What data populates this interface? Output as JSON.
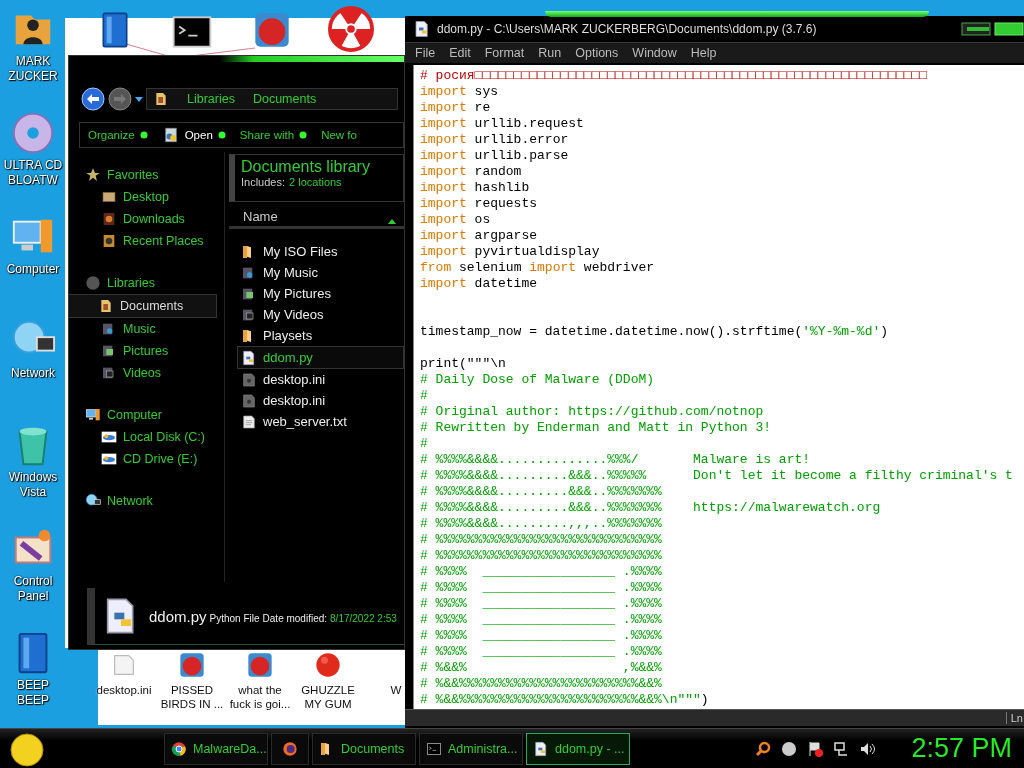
{
  "desktop": {
    "icons": [
      {
        "label": "MARK ZUCKER",
        "kind": "user"
      },
      {
        "label": "ULTRA CD BLOATW",
        "kind": "disc"
      },
      {
        "label": "Computer",
        "kind": "computer"
      },
      {
        "label": "Network",
        "kind": "network"
      },
      {
        "label": "Windows Vista",
        "kind": "recycle"
      },
      {
        "label": "Control Panel",
        "kind": "control"
      },
      {
        "label": "BEEP BEEP",
        "kind": "book"
      }
    ],
    "bottom_icons": [
      {
        "label": "desktop.ini",
        "kind": "paper"
      },
      {
        "label": "PISSED BIRDS IN ...",
        "kind": "game"
      },
      {
        "label": "what the fuck is goi...",
        "kind": "game"
      },
      {
        "label": "GHUZZLE MY GUM",
        "kind": "fuzzy"
      },
      {
        "label": "W",
        "kind": "blank"
      }
    ]
  },
  "explorer": {
    "breadcrumb": [
      "Libraries",
      "Documents"
    ],
    "toolbar": [
      {
        "label": "Organize",
        "kind": "menu"
      },
      {
        "label": "Open",
        "kind": "open"
      },
      {
        "label": "Share with",
        "kind": "menu"
      },
      {
        "label": "New fo",
        "kind": "plain"
      }
    ],
    "nav": [
      {
        "label": "Favorites",
        "kind": "star",
        "selected": false,
        "children": [
          {
            "label": "Desktop",
            "kind": "desktop",
            "selected": false
          },
          {
            "label": "Downloads",
            "kind": "downloads",
            "selected": false
          },
          {
            "label": "Recent Places",
            "kind": "recent",
            "selected": false
          }
        ]
      },
      {
        "label": "Libraries",
        "kind": "libraries",
        "selected": false,
        "children": [
          {
            "label": "Documents",
            "kind": "documents",
            "selected": true
          },
          {
            "label": "Music",
            "kind": "music",
            "selected": false
          },
          {
            "label": "Pictures",
            "kind": "pictures",
            "selected": false
          },
          {
            "label": "Videos",
            "kind": "videos",
            "selected": false
          }
        ]
      },
      {
        "label": "Computer",
        "kind": "computer",
        "selected": false,
        "children": [
          {
            "label": "Local Disk (C:)",
            "kind": "drive",
            "selected": false
          },
          {
            "label": "CD Drive (E:)",
            "kind": "drive",
            "selected": false
          }
        ]
      },
      {
        "label": "Network",
        "kind": "network",
        "selected": false
      }
    ],
    "library": {
      "title": "Documents library",
      "includes_label": "Includes:",
      "locations": "2 locations"
    },
    "column": "Name",
    "files": [
      {
        "name": "My ISO Files",
        "kind": "folder",
        "selected": false
      },
      {
        "name": "My Music",
        "kind": "music",
        "selected": false
      },
      {
        "name": "My Pictures",
        "kind": "pictures",
        "selected": false
      },
      {
        "name": "My Videos",
        "kind": "videos",
        "selected": false
      },
      {
        "name": "Playsets",
        "kind": "folder",
        "selected": false
      },
      {
        "name": "ddom.py",
        "kind": "python",
        "selected": true
      },
      {
        "name": "desktop.ini",
        "kind": "settings",
        "selected": false
      },
      {
        "name": "desktop.ini",
        "kind": "settings",
        "selected": false
      },
      {
        "name": "web_server.txt",
        "kind": "text",
        "selected": false
      }
    ],
    "details": {
      "name": "ddom.py",
      "type": "Python File",
      "date_label": "Date modified:",
      "date": "8/17/2022 2:53"
    }
  },
  "editor": {
    "title": "ddom.py - C:\\Users\\MARK ZUCKERBERG\\Documents\\ddom.py (3.7.6)",
    "menu": [
      "File",
      "Edit",
      "Format",
      "Run",
      "Options",
      "Window",
      "Help"
    ],
    "lines": [
      {
        "kind": "code",
        "tokens": [
          {
            "kind": "comment",
            "text": "# росия□□□□□□□□□□□□□□□□□□□□□□□□□□□□□□□□□□□□□□□□□□□□□□□□□□□□□□□□□□"
          }
        ]
      },
      {
        "kind": "code",
        "tokens": [
          {
            "kind": "keyword",
            "text": "import"
          },
          {
            "kind": "text",
            "text": " sys"
          }
        ]
      },
      {
        "kind": "code",
        "tokens": [
          {
            "kind": "keyword",
            "text": "import"
          },
          {
            "kind": "text",
            "text": " re"
          }
        ]
      },
      {
        "kind": "code",
        "tokens": [
          {
            "kind": "keyword",
            "text": "import"
          },
          {
            "kind": "text",
            "text": " urllib.request"
          }
        ]
      },
      {
        "kind": "code",
        "tokens": [
          {
            "kind": "keyword",
            "text": "import"
          },
          {
            "kind": "text",
            "text": " urllib.error"
          }
        ]
      },
      {
        "kind": "code",
        "tokens": [
          {
            "kind": "keyword",
            "text": "import"
          },
          {
            "kind": "text",
            "text": " urllib.parse"
          }
        ]
      },
      {
        "kind": "code",
        "tokens": [
          {
            "kind": "keyword",
            "text": "import"
          },
          {
            "kind": "text",
            "text": " random"
          }
        ]
      },
      {
        "kind": "code",
        "tokens": [
          {
            "kind": "keyword",
            "text": "import"
          },
          {
            "kind": "text",
            "text": " hashlib"
          }
        ]
      },
      {
        "kind": "code",
        "tokens": [
          {
            "kind": "keyword",
            "text": "import"
          },
          {
            "kind": "text",
            "text": " requests"
          }
        ]
      },
      {
        "kind": "code",
        "tokens": [
          {
            "kind": "keyword",
            "text": "import"
          },
          {
            "kind": "text",
            "text": " os"
          }
        ]
      },
      {
        "kind": "code",
        "tokens": [
          {
            "kind": "keyword",
            "text": "import"
          },
          {
            "kind": "text",
            "text": " argparse"
          }
        ]
      },
      {
        "kind": "code",
        "tokens": [
          {
            "kind": "keyword",
            "text": "import"
          },
          {
            "kind": "text",
            "text": " pyvirtualdisplay"
          }
        ]
      },
      {
        "kind": "code",
        "tokens": [
          {
            "kind": "keyword",
            "text": "from"
          },
          {
            "kind": "text",
            "text": " selenium "
          },
          {
            "kind": "keyword",
            "text": "import"
          },
          {
            "kind": "text",
            "text": " webdriver"
          }
        ]
      },
      {
        "kind": "code",
        "tokens": [
          {
            "kind": "keyword",
            "text": "import"
          },
          {
            "kind": "text",
            "text": " datetime"
          }
        ]
      },
      {
        "kind": "blank"
      },
      {
        "kind": "blank"
      },
      {
        "kind": "code",
        "tokens": [
          {
            "kind": "text",
            "text": "timestamp_now = datetime.datetime.now().strftime("
          },
          {
            "kind": "string",
            "text": "'%Y-%m-%d'"
          },
          {
            "kind": "text",
            "text": ")"
          }
        ]
      },
      {
        "kind": "blank"
      },
      {
        "kind": "code",
        "tokens": [
          {
            "kind": "text",
            "text": "print(\"\"\"\\n"
          }
        ]
      },
      {
        "kind": "code",
        "tokens": [
          {
            "kind": "string",
            "text": "# Daily Dose of Malware (DDoM)"
          }
        ]
      },
      {
        "kind": "code",
        "tokens": [
          {
            "kind": "string",
            "text": "#"
          }
        ]
      },
      {
        "kind": "code",
        "tokens": [
          {
            "kind": "string",
            "text": "# Original author: https://github.com/notnop"
          }
        ]
      },
      {
        "kind": "code",
        "tokens": [
          {
            "kind": "string",
            "text": "# Rewritten by Enderman and Matt in Python 3!"
          }
        ]
      },
      {
        "kind": "code",
        "tokens": [
          {
            "kind": "string",
            "text": "#"
          }
        ]
      },
      {
        "kind": "code",
        "tokens": [
          {
            "kind": "string",
            "text": "# %%%%&&&&..............%%%/       Malware is art!"
          }
        ]
      },
      {
        "kind": "code",
        "tokens": [
          {
            "kind": "string",
            "text": "# %%%%&&&&.........&&&..%%%%%      Don't let it become a filthy criminal's t"
          }
        ]
      },
      {
        "kind": "code",
        "tokens": [
          {
            "kind": "string",
            "text": "# %%%%&&&&.........&&&..%%%%%%%"
          }
        ]
      },
      {
        "kind": "code",
        "tokens": [
          {
            "kind": "string",
            "text": "# %%%%&&&&.........&&&..%%%%%%%    https://malwarewatch.org"
          }
        ]
      },
      {
        "kind": "code",
        "tokens": [
          {
            "kind": "string",
            "text": "# %%%%&&&&.........,,,..%%%%%%%"
          }
        ]
      },
      {
        "kind": "code",
        "tokens": [
          {
            "kind": "string",
            "text": "# %%%%%%%%%%%%%%%%%%%%%%%%%%%%%"
          }
        ]
      },
      {
        "kind": "code",
        "tokens": [
          {
            "kind": "string",
            "text": "# %%%%%%%%%%%%%%%%%%%%%%%%%%%%%"
          }
        ]
      },
      {
        "kind": "code",
        "tokens": [
          {
            "kind": "string",
            "text": "# %%%%  _________________ .%%%%"
          }
        ]
      },
      {
        "kind": "code",
        "tokens": [
          {
            "kind": "string",
            "text": "# %%%%  _________________ .%%%%"
          }
        ]
      },
      {
        "kind": "code",
        "tokens": [
          {
            "kind": "string",
            "text": "# %%%%  _________________ .%%%%"
          }
        ]
      },
      {
        "kind": "code",
        "tokens": [
          {
            "kind": "string",
            "text": "# %%%%  _________________ .%%%%"
          }
        ]
      },
      {
        "kind": "code",
        "tokens": [
          {
            "kind": "string",
            "text": "# %%%%  _________________ .%%%%"
          }
        ]
      },
      {
        "kind": "code",
        "tokens": [
          {
            "kind": "string",
            "text": "# %%%%  _________________ .%%%%"
          }
        ]
      },
      {
        "kind": "code",
        "tokens": [
          {
            "kind": "string",
            "text": "# %&&%                    ,%&&%"
          }
        ]
      },
      {
        "kind": "code",
        "tokens": [
          {
            "kind": "string",
            "text": "# %&&%%%%%%%%%%%%%%%%%%%%%%%&&%"
          }
        ]
      },
      {
        "kind": "code",
        "tokens": [
          {
            "kind": "string",
            "text": "# %&&%%%%%%%%%%%%%%%%%%%%%%%&&%\\n\"\"\""
          },
          {
            "kind": "text",
            "text": ")"
          }
        ]
      }
    ],
    "status": "Ln"
  },
  "taskbar": {
    "tasks": [
      {
        "label": "MalwareDa...",
        "kind": "browser",
        "selected": false
      },
      {
        "kind": "firefox",
        "selected": false
      },
      {
        "label": "Documents",
        "kind": "folder",
        "selected": false
      },
      {
        "label": "Administra...",
        "kind": "console",
        "selected": false
      },
      {
        "label": "ddom.py - ...",
        "kind": "python",
        "selected": true
      }
    ],
    "clock": "2:57 PM"
  }
}
